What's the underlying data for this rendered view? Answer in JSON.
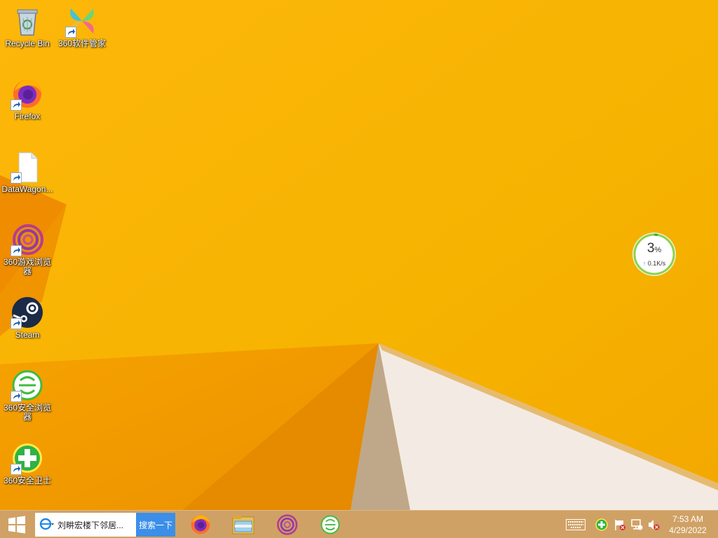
{
  "desktop": {
    "icons": [
      {
        "label": "Recycle Bin",
        "icon": "recycle-bin-icon",
        "shortcut": false
      },
      {
        "label": "360软件管家",
        "icon": "360-software-manager-icon",
        "shortcut": true
      },
      {
        "label": "Firefox",
        "icon": "firefox-icon",
        "shortcut": true
      },
      {
        "label": "DataWagon...",
        "icon": "document-icon",
        "shortcut": true
      },
      {
        "label": "360游戏浏览器",
        "icon": "360-game-browser-icon",
        "shortcut": true
      },
      {
        "label": "Steam",
        "icon": "steam-icon",
        "shortcut": true
      },
      {
        "label": "360安全浏览器",
        "icon": "360-secure-browser-icon",
        "shortcut": true
      },
      {
        "label": "360安全卫士",
        "icon": "360-security-guard-icon",
        "shortcut": true
      }
    ]
  },
  "net_widget": {
    "percent_value": "3",
    "percent_sign": "%",
    "speed": "0.1K/s",
    "ring_color": "#8fd14f"
  },
  "taskbar": {
    "search_text": "刘畊宏楼下邻居...",
    "search_button": "搜索一下",
    "pinned_apps": [
      "firefox-icon",
      "file-explorer-icon",
      "360-game-browser-icon",
      "360-secure-browser-icon"
    ],
    "tray_icons": [
      "keyboard-icon",
      "360-security-tray-icon",
      "action-center-flag-icon",
      "network-icon",
      "volume-muted-icon"
    ],
    "clock": {
      "time": "7:53 AM",
      "date": "4/29/2022"
    }
  },
  "colors": {
    "wallpaper": "#f7b500",
    "taskbar": "#cca06e",
    "search_button": "#3b8fe8"
  }
}
